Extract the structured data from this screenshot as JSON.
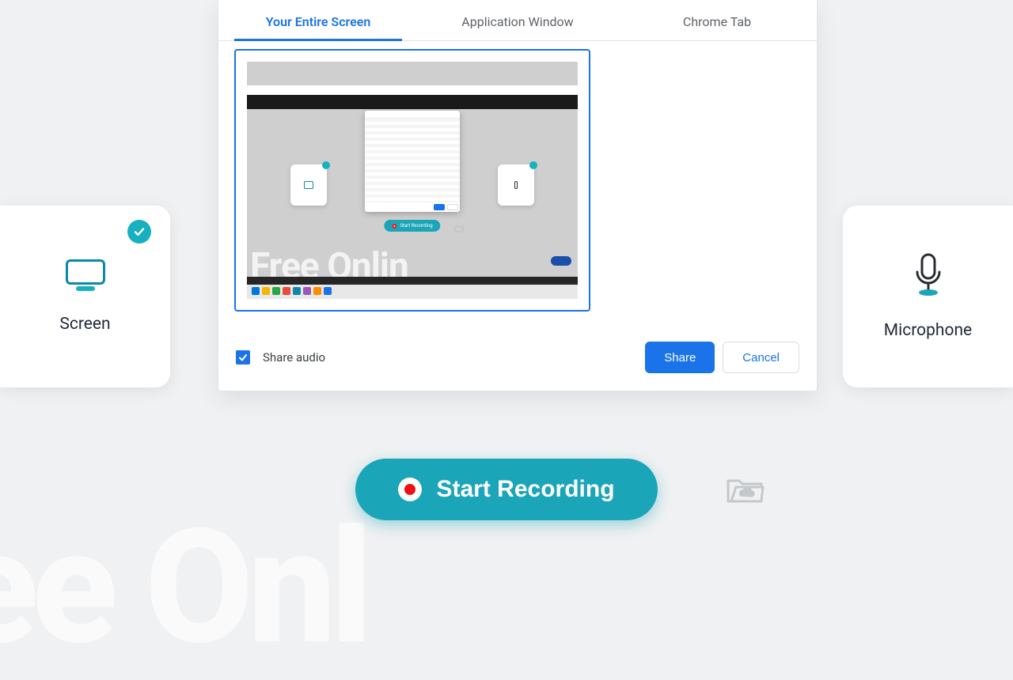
{
  "sources": {
    "screen": {
      "label": "Screen",
      "selected": true
    },
    "microphone": {
      "label": "Microphone",
      "selected": false
    }
  },
  "dialog": {
    "tabs": [
      {
        "label": "Your Entire Screen",
        "active": true
      },
      {
        "label": "Application Window",
        "active": false
      },
      {
        "label": "Chrome Tab",
        "active": false
      }
    ],
    "share_audio_label": "Share audio",
    "share_audio_checked": true,
    "share_button": "Share",
    "cancel_button": "Cancel",
    "preview_inner_button": "Start Recording",
    "preview_watermark": "Free Onlin"
  },
  "actions": {
    "start_recording": "Start Recording"
  },
  "colors": {
    "accent_blue": "#1a73e8",
    "accent_teal": "#1ba5b8",
    "badge_teal": "#17b0c1"
  }
}
